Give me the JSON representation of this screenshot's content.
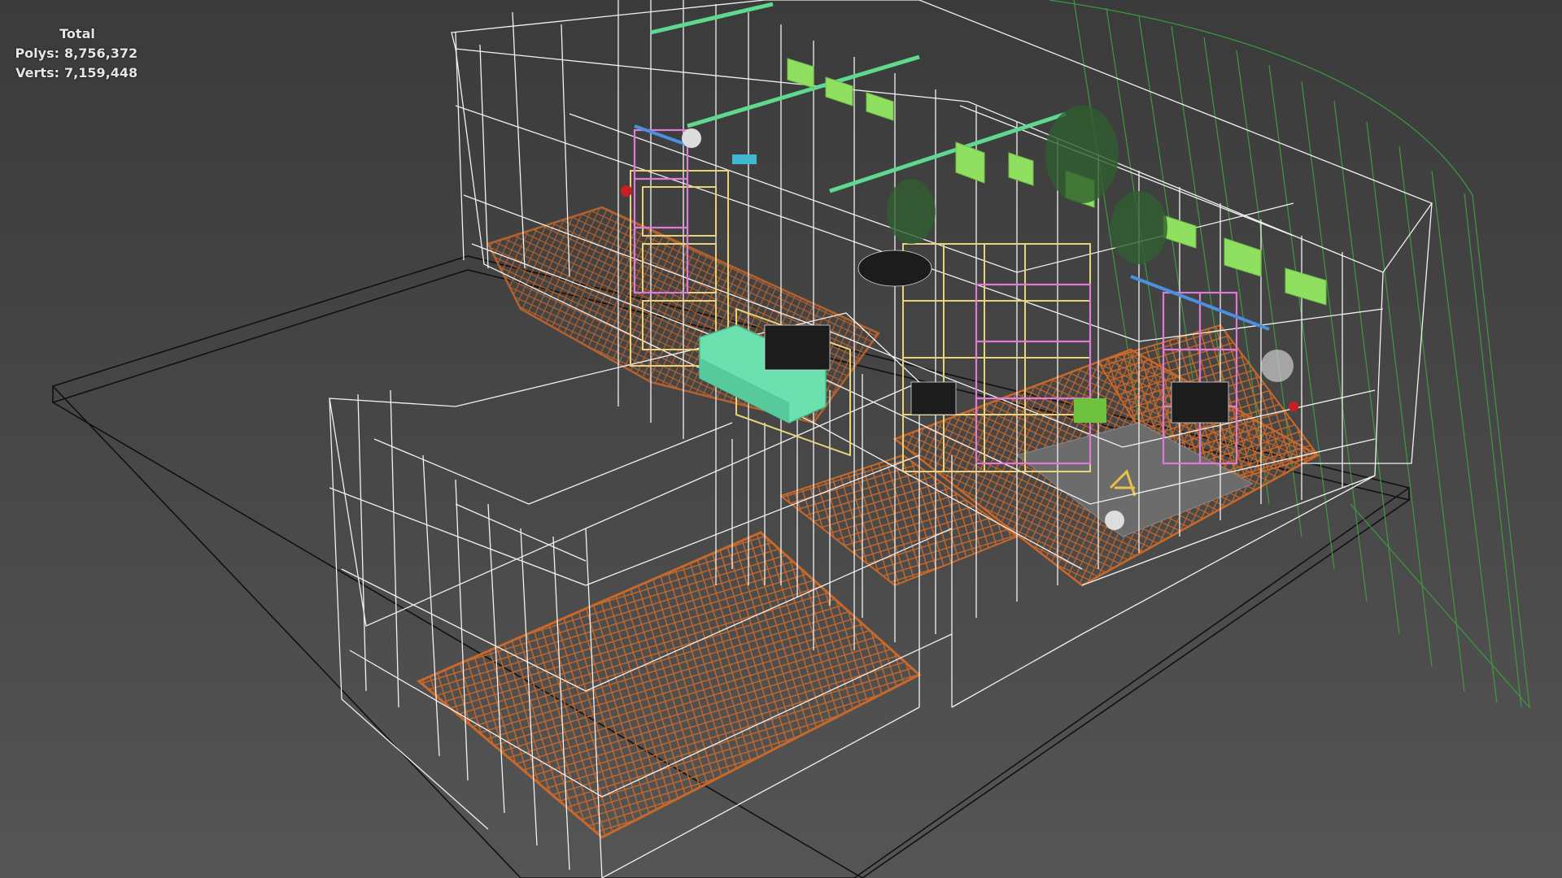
{
  "viewport": {
    "stats": {
      "title": "Total",
      "polys_label": "Polys:",
      "polys_value": "8,756,372",
      "verts_label": "Verts:",
      "verts_value": "7,159,448"
    }
  },
  "colors": {
    "background": "#3a3a3a",
    "wire": "#f2f2f2",
    "floor": "#c8682a",
    "gizmo": "#3e9a3e",
    "cabinet_yellow": "#e8d37a",
    "cabinet_pink": "#e07ad8",
    "sofa": "#6de0b0",
    "light_green": "#8fe060",
    "track_light": "#5fd890",
    "rail_blue": "#4b8fe0"
  },
  "icons": [
    "scene-wireframe",
    "floor-herringbone",
    "sofa",
    "shelving-unit",
    "track-light"
  ]
}
